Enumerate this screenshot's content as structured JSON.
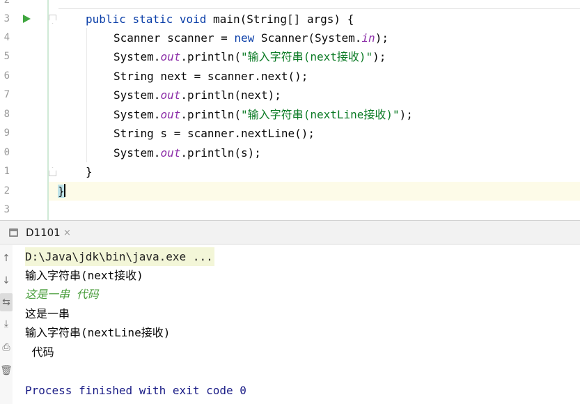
{
  "editor": {
    "line_numbers": [
      "2",
      "3",
      "4",
      "5",
      "6",
      "7",
      "8",
      "9",
      "0",
      "1",
      "2",
      "3"
    ],
    "code": {
      "main_sig": {
        "kw1": "public",
        "kw2": "static",
        "kw3": "void",
        "rest": " main(String[] args) {"
      },
      "scanner_decl": {
        "prefix": "Scanner scanner = ",
        "kw": "new",
        "mid": " Scanner(System.",
        "field": "in",
        "suffix": ");"
      },
      "print_prompt1": {
        "prefix": "System.",
        "field": "out",
        "mid": ".println(",
        "str": "\"输入字符串(next接收)\"",
        "suffix": ");"
      },
      "next_decl": "String next = scanner.next();",
      "print_next": {
        "prefix": "System.",
        "field": "out",
        "suffix": ".println(next);"
      },
      "print_prompt2": {
        "prefix": "System.",
        "field": "out",
        "mid": ".println(",
        "str": "\"输入字符串(nextLine接收)\"",
        "suffix": ");"
      },
      "nextline_decl": "String s = scanner.nextLine();",
      "print_s": {
        "prefix": "System.",
        "field": "out",
        "suffix": ".println(s);"
      },
      "method_close": "}",
      "class_close": "}"
    }
  },
  "run_panel": {
    "tab_label": "D1101",
    "tab_close": "×",
    "toolbar_icons": [
      "↑",
      "↓",
      "⇆",
      "⤓",
      "⎙",
      "🗑"
    ],
    "console": {
      "command": "D:\\Java\\jdk\\bin\\java.exe ...",
      "prompt1": "输入字符串(next接收)",
      "user_input": "这是一串 代码",
      "output1": "这是一串",
      "prompt2": "输入字符串(nextLine接收)",
      "output2": " 代码",
      "exit_message": "Process finished with exit code 0"
    }
  },
  "colors": {
    "keyword": "#0a3ea8",
    "string": "#0a7a24",
    "static_field": "#8c2ea8",
    "user_input": "#4b9e3e",
    "exit_message": "#1a1c86",
    "run_icon": "#3fa63f"
  }
}
